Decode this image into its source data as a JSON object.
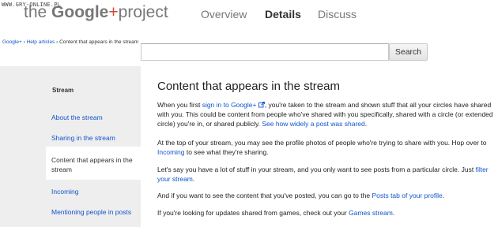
{
  "watermark": "WWW.GRY-ONLINE.PL",
  "logo": {
    "prefix": "the ",
    "brand": "Google",
    "plus": "+",
    "suffix": "project"
  },
  "nav": [
    "Overview",
    "Details",
    "Discuss"
  ],
  "nav_active": "Details",
  "breadcrumb": {
    "items": [
      "Google+",
      "Help articles"
    ],
    "separator": " › ",
    "current": "Content that appears in the stream"
  },
  "search": {
    "value": "",
    "button_label": "Search"
  },
  "sidebar": {
    "title": "Stream",
    "items": [
      "About the stream",
      "Sharing in the stream",
      "Content that appears in the stream",
      "Incoming",
      "Mentioning people in posts"
    ]
  },
  "article": {
    "title": "Content that appears in the stream",
    "p1": {
      "t1": "When you first ",
      "link1": "sign in to Google+",
      "link1_icon": "external-link-icon",
      "t2": ", you're taken to the stream and shown stuff that all your circles have shared with you. This could be content from people who've shared with you specifically, shared with a circle (or extended circle) you're in, or shared publicly. ",
      "link2": "See how widely a post was shared",
      "t3": "."
    },
    "p2": {
      "t1": "At the top of your stream, you may see the profile photos of people who're trying to share with you. Hop over to ",
      "link": "Incoming",
      "t2": " to see what they're sharing."
    },
    "p3": {
      "t1": "Let's say you have a lot of stuff in your stream, and you only want to see posts from a particular circle. Just ",
      "link": "filter your stream",
      "t2": "."
    },
    "p4": {
      "t1": "And if you want to see the content that you've posted, you can go to the ",
      "link": "Posts tab of your profile",
      "t2": "."
    },
    "p5": {
      "t1": "If you're looking for updates shared from games, check out your ",
      "link": "Games stream",
      "t2": "."
    }
  }
}
